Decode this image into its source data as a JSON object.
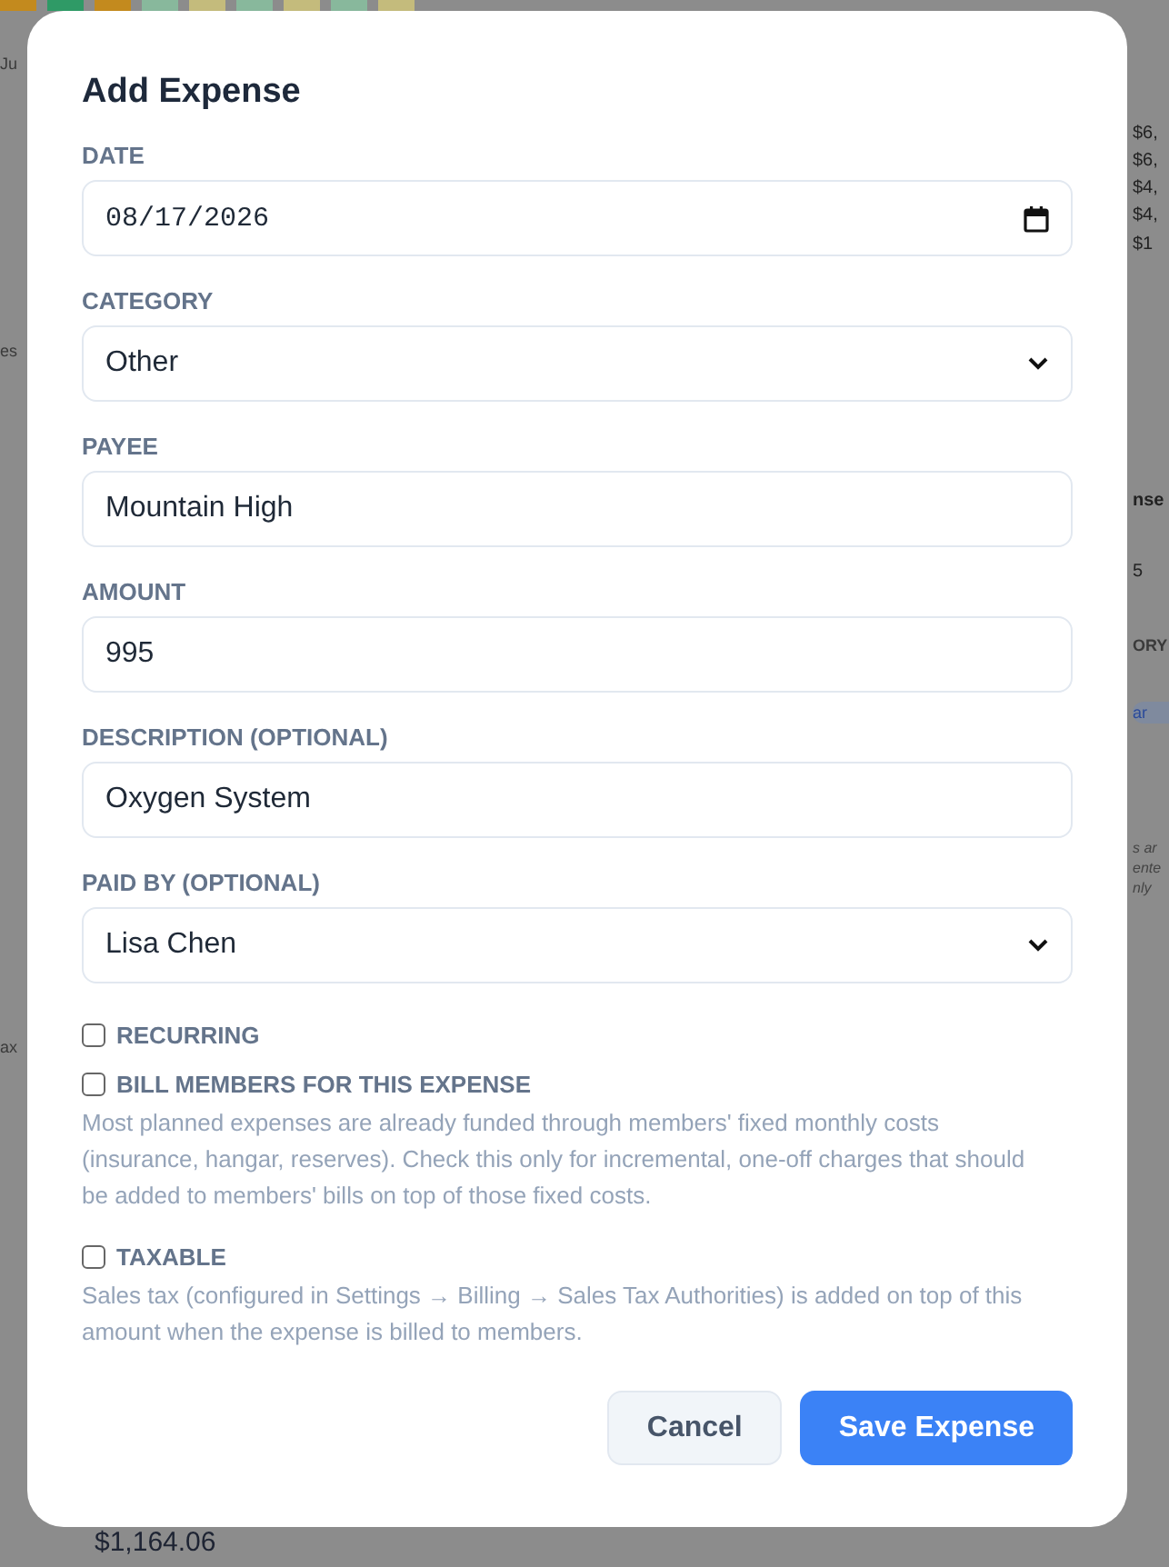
{
  "background": {
    "left_fragments": [
      "Ju",
      "es",
      "ax"
    ],
    "right_fragments": [
      {
        "kind": "amount",
        "text": "$6,"
      },
      {
        "kind": "amount",
        "text": "$6,"
      },
      {
        "kind": "amount",
        "text": "$4,"
      },
      {
        "kind": "amount",
        "text": "$4,"
      },
      {
        "kind": "amount",
        "text": "$1"
      },
      {
        "kind": "heading",
        "text": "nse"
      },
      {
        "kind": "value",
        "text": "5"
      },
      {
        "kind": "header",
        "text": "ORY"
      },
      {
        "kind": "tag",
        "text": "ar"
      },
      {
        "kind": "note",
        "text": "s ar"
      },
      {
        "kind": "note",
        "text": "ente"
      },
      {
        "kind": "note",
        "text": "nly"
      }
    ],
    "total": "$1,164.06"
  },
  "dialog": {
    "title": "Add Expense",
    "fields": [
      {
        "kind": "date",
        "label": "DATE",
        "value": "08/17/2026"
      },
      {
        "kind": "select",
        "label": "CATEGORY",
        "value": "Other"
      },
      {
        "kind": "text",
        "label": "PAYEE",
        "value": "Mountain High"
      },
      {
        "kind": "text",
        "label": "AMOUNT",
        "value": "995"
      },
      {
        "kind": "text",
        "label": "DESCRIPTION (OPTIONAL)",
        "value": "Oxygen System"
      },
      {
        "kind": "select",
        "label": "PAID BY (OPTIONAL)",
        "value": "Lisa Chen"
      }
    ],
    "options": [
      {
        "label": "RECURRING",
        "checked": false
      },
      {
        "label": "BILL MEMBERS FOR THIS EXPENSE",
        "checked": false,
        "help": "Most planned expenses are already funded through members' fixed monthly costs (insurance, hangar, reserves). Check this only for incremental, one-off charges that should be added to members' bills on top of those fixed costs."
      },
      {
        "label": "TAXABLE",
        "checked": false,
        "help": "Sales tax (configured in Settings → Billing → Sales Tax Authorities) is added on top of this amount when the expense is billed to members."
      }
    ],
    "buttons": [
      {
        "kind": "secondary",
        "label": "Cancel"
      },
      {
        "kind": "primary",
        "label": "Save Expense"
      }
    ]
  }
}
